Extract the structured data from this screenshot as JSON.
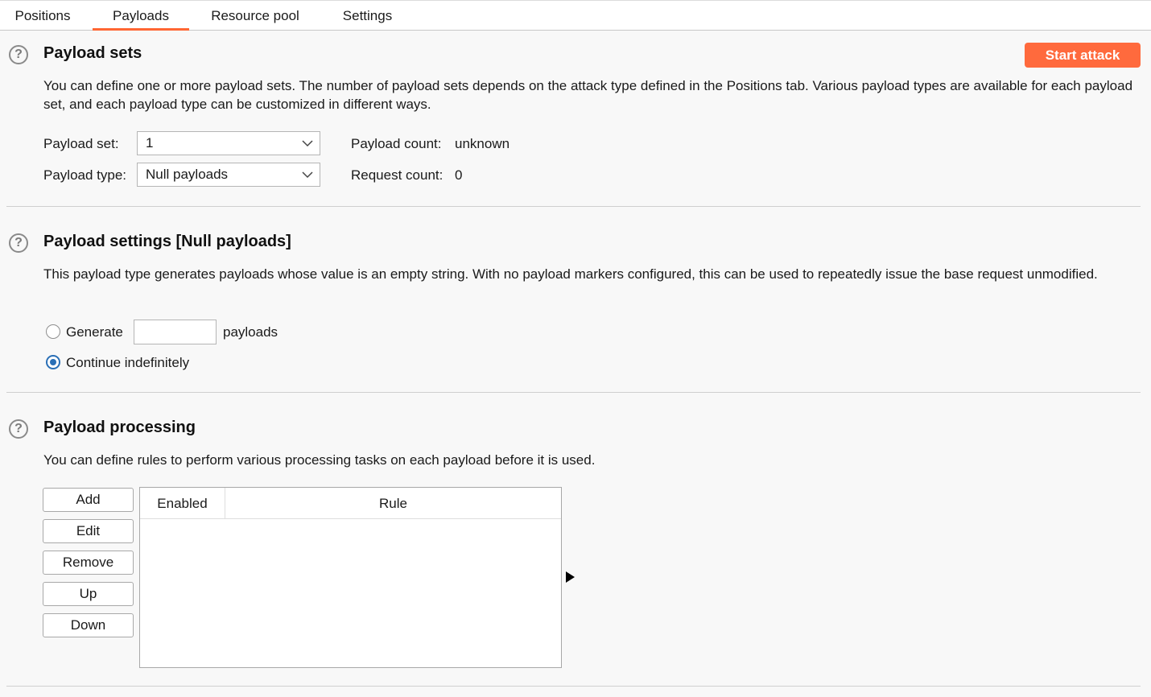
{
  "tabs": [
    {
      "label": "Positions",
      "active": false
    },
    {
      "label": "Payloads",
      "active": true
    },
    {
      "label": "Resource pool",
      "active": false
    },
    {
      "label": "Settings",
      "active": false
    }
  ],
  "accent_color": "#ff6633",
  "payload_sets": {
    "title": "Payload sets",
    "start_attack_label": "Start attack",
    "description": "You can define one or more payload sets. The number of payload sets depends on the attack type defined in the Positions tab. Various payload types are available for each payload set, and each payload type can be customized in different ways.",
    "payload_set_label": "Payload set:",
    "payload_set_value": "1",
    "payload_type_label": "Payload type:",
    "payload_type_value": "Null payloads",
    "payload_count_label": "Payload count:",
    "payload_count_value": "unknown",
    "request_count_label": "Request count:",
    "request_count_value": "0"
  },
  "payload_settings": {
    "title": "Payload settings [Null payloads]",
    "description": "This payload type generates payloads whose value is an empty string. With no payload markers configured, this can be used to repeatedly issue the base request unmodified.",
    "generate_label": "Generate",
    "generate_value": "",
    "generate_suffix": "payloads",
    "continue_label": "Continue indefinitely",
    "selected_option": "continue"
  },
  "payload_processing": {
    "title": "Payload processing",
    "description": "You can define rules to perform various processing tasks on each payload before it is used.",
    "buttons": {
      "add": "Add",
      "edit": "Edit",
      "remove": "Remove",
      "up": "Up",
      "down": "Down"
    },
    "columns": {
      "enabled": "Enabled",
      "rule": "Rule"
    },
    "rows": []
  }
}
